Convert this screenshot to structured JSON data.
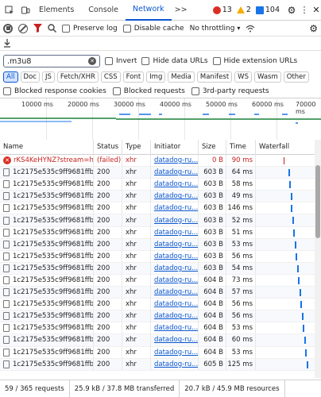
{
  "devtools": {
    "tabs": [
      "Elements",
      "Console",
      "Network"
    ],
    "active_tab": "Network",
    "more": ">>",
    "errors": "13",
    "warnings": "2",
    "info": "104"
  },
  "toolbar": {
    "preserve_log": "Preserve log",
    "disable_cache": "Disable cache",
    "throttling": "No throttling"
  },
  "filter": {
    "value": ".m3u8",
    "invert": "Invert",
    "hide_data_urls": "Hide data URLs",
    "hide_ext_urls": "Hide extension URLs",
    "chips": [
      "All",
      "Doc",
      "JS",
      "Fetch/XHR",
      "CSS",
      "Font",
      "Img",
      "Media",
      "Manifest",
      "WS",
      "Wasm",
      "Other"
    ],
    "blocked_cookies": "Blocked response cookies",
    "blocked_requests": "Blocked requests",
    "third_party": "3rd-party requests"
  },
  "overview": {
    "ticks": [
      "10000 ms",
      "20000 ms",
      "30000 ms",
      "40000 ms",
      "50000 ms",
      "60000 ms",
      "70000 ms"
    ]
  },
  "table": {
    "headers": [
      "Name",
      "Status",
      "Type",
      "Initiator",
      "Size",
      "Time",
      "Waterfall"
    ],
    "rows": [
      {
        "name": "rKS4KeHYNZ?stream=h...",
        "status": "(failed)",
        "type": "xhr",
        "initiator": "datadog-ru...",
        "size": "0 B",
        "time": "90 ms",
        "error": true,
        "wf": 0.47
      },
      {
        "name": "1c2175e535c9ff9681ffb...",
        "status": "200",
        "type": "xhr",
        "initiator": "datadog-ru...",
        "size": "603 B",
        "time": "64 ms",
        "wf": 0.55
      },
      {
        "name": "1c2175e535c9ff9681ffb...",
        "status": "200",
        "type": "xhr",
        "initiator": "datadog-ru...",
        "size": "603 B",
        "time": "58 ms",
        "wf": 0.57
      },
      {
        "name": "1c2175e535c9ff9681ffb...",
        "status": "200",
        "type": "xhr",
        "initiator": "datadog-ru...",
        "size": "603 B",
        "time": "49 ms",
        "wf": 0.59
      },
      {
        "name": "1c2175e535c9ff9681ffb...",
        "status": "200",
        "type": "xhr",
        "initiator": "datadog-ru...",
        "size": "603 B",
        "time": "146 ms",
        "wf": 0.6
      },
      {
        "name": "1c2175e535c9ff9681ffb...",
        "status": "200",
        "type": "xhr",
        "initiator": "datadog-ru...",
        "size": "603 B",
        "time": "52 ms",
        "wf": 0.62
      },
      {
        "name": "1c2175e535c9ff9681ffb...",
        "status": "200",
        "type": "xhr",
        "initiator": "datadog-ru...",
        "size": "603 B",
        "time": "51 ms",
        "wf": 0.64
      },
      {
        "name": "1c2175e535c9ff9681ffb...",
        "status": "200",
        "type": "xhr",
        "initiator": "datadog-ru...",
        "size": "603 B",
        "time": "53 ms",
        "wf": 0.66
      },
      {
        "name": "1c2175e535c9ff9681ffb...",
        "status": "200",
        "type": "xhr",
        "initiator": "datadog-ru...",
        "size": "603 B",
        "time": "56 ms",
        "wf": 0.68
      },
      {
        "name": "1c2175e535c9ff9681ffb...",
        "status": "200",
        "type": "xhr",
        "initiator": "datadog-ru...",
        "size": "603 B",
        "time": "54 ms",
        "wf": 0.7
      },
      {
        "name": "1c2175e535c9ff9681ffb...",
        "status": "200",
        "type": "xhr",
        "initiator": "datadog-ru...",
        "size": "604 B",
        "time": "73 ms",
        "wf": 0.72
      },
      {
        "name": "1c2175e535c9ff9681ffb...",
        "status": "200",
        "type": "xhr",
        "initiator": "datadog-ru...",
        "size": "604 B",
        "time": "57 ms",
        "wf": 0.74
      },
      {
        "name": "1c2175e535c9ff9681ffb...",
        "status": "200",
        "type": "xhr",
        "initiator": "datadog-ru...",
        "size": "604 B",
        "time": "56 ms",
        "wf": 0.76
      },
      {
        "name": "1c2175e535c9ff9681ffb...",
        "status": "200",
        "type": "xhr",
        "initiator": "datadog-ru...",
        "size": "604 B",
        "time": "56 ms",
        "wf": 0.78
      },
      {
        "name": "1c2175e535c9ff9681ffb...",
        "status": "200",
        "type": "xhr",
        "initiator": "datadog-ru...",
        "size": "604 B",
        "time": "53 ms",
        "wf": 0.8
      },
      {
        "name": "1c2175e535c9ff9681ffb...",
        "status": "200",
        "type": "xhr",
        "initiator": "datadog-ru...",
        "size": "604 B",
        "time": "60 ms",
        "wf": 0.82
      },
      {
        "name": "1c2175e535c9ff9681ffb...",
        "status": "200",
        "type": "xhr",
        "initiator": "datadog-ru...",
        "size": "604 B",
        "time": "53 ms",
        "wf": 0.84
      },
      {
        "name": "1c2175e535c9ff9681ffb...",
        "status": "200",
        "type": "xhr",
        "initiator": "datadog-ru...",
        "size": "605 B",
        "time": "125 ms",
        "wf": 0.86
      }
    ]
  },
  "statusbar": {
    "requests": "59 / 365 requests",
    "transferred": "25.9 kB / 37.8 MB transferred",
    "resources": "20.7 kB / 45.9 MB resources"
  },
  "colors": {
    "accent": "#0b57d0",
    "error": "#c5221f",
    "warning": "#f9ab00",
    "info": "#1a73e8"
  }
}
